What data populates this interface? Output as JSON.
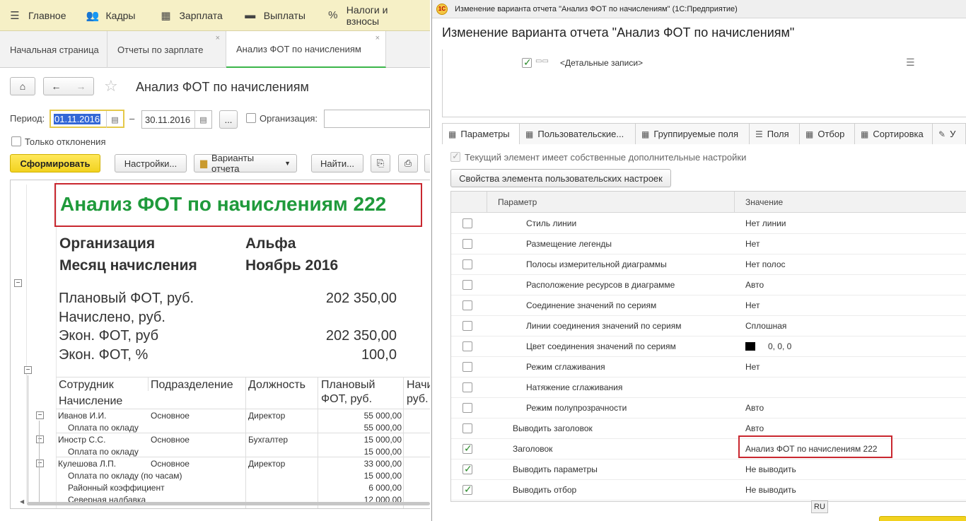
{
  "left": {
    "menu": [
      {
        "icon": "menu-icon",
        "label": "Главное"
      },
      {
        "icon": "people-icon",
        "label": "Кадры"
      },
      {
        "icon": "calculator-icon",
        "label": "Зарплата"
      },
      {
        "icon": "wallet-icon",
        "label": "Выплаты"
      },
      {
        "icon": "percent-icon",
        "label": "Налоги и взносы"
      }
    ],
    "tabs": [
      "Начальная страница",
      "Отчеты по зарплате",
      "Анализ ФОТ по начислениям"
    ],
    "doc_title": "Анализ ФОТ по начислениям",
    "period_label": "Период:",
    "period_from": "01.11.2016",
    "period_dash": "–",
    "period_to": "30.11.2016",
    "dots": "...",
    "org_label": "Организация:",
    "only_deviations": "Только отклонения",
    "buttons": {
      "generate": "Сформировать",
      "settings": "Настройки...",
      "variants": "Варианты отчета",
      "find": "Найти..."
    },
    "report": {
      "title": "Анализ ФОТ по начислениям 222",
      "org_label": "Организация",
      "org_value": "Альфа",
      "month_label": "Месяц начисления",
      "month_value": "Ноябрь 2016",
      "summary": [
        {
          "label": "Плановый ФОТ, руб.",
          "value": "202 350,00"
        },
        {
          "label": "Начислено, руб.",
          "value": ""
        },
        {
          "label": "Экон. ФОТ, руб",
          "value": "202 350,00"
        },
        {
          "label": "Экон. ФОТ, %",
          "value": "100,0"
        }
      ],
      "headers": {
        "employee": "Сотрудник",
        "division": "Подразделение",
        "position": "Должность",
        "plan1": "Плановый",
        "plan2": "ФОТ, руб.",
        "acc1": "Начи",
        "acc2": "руб.",
        "accrual": "Начисление"
      },
      "rows": [
        {
          "name": "Иванов И.И.",
          "div": "Основное",
          "pos": "Директор",
          "plan": "55 000,00",
          "level": 0
        },
        {
          "name": "Оплата по окладу",
          "div": "",
          "pos": "",
          "plan": "55 000,00",
          "level": 1
        },
        {
          "name": "Иностр С.С.",
          "div": "Основное",
          "pos": "Бухгалтер",
          "plan": "15 000,00",
          "level": 0
        },
        {
          "name": "Оплата по окладу",
          "div": "",
          "pos": "",
          "plan": "15 000,00",
          "level": 1
        },
        {
          "name": "Кулешова Л.П.",
          "div": "Основное",
          "pos": "Директор",
          "plan": "33 000,00",
          "level": 0
        },
        {
          "name": "Оплата по окладу (по часам)",
          "div": "",
          "pos": "",
          "plan": "15 000,00",
          "level": 1
        },
        {
          "name": "Районный коэффициент",
          "div": "",
          "pos": "",
          "plan": "6 000,00",
          "level": 1
        },
        {
          "name": "Северная надбавка",
          "div": "",
          "pos": "",
          "plan": "12 000,00",
          "level": 1
        }
      ]
    }
  },
  "right": {
    "window_title": "Изменение варианта отчета \"Анализ ФОТ по начислениям\"  (1С:Предприятие)",
    "form_title": "Изменение варианта отчета \"Анализ ФОТ по начислениям\"",
    "detail_records": "<Детальные записи>",
    "tabs": [
      {
        "icon": "table-icon",
        "label": "Параметры"
      },
      {
        "icon": "table-icon",
        "label": "Пользовательские..."
      },
      {
        "icon": "table-icon",
        "label": "Группируемые поля"
      },
      {
        "icon": "list-icon",
        "label": "Поля"
      },
      {
        "icon": "table-icon",
        "label": "Отбор"
      },
      {
        "icon": "table-icon",
        "label": "Сортировка"
      },
      {
        "icon": "brush-icon",
        "label": "У"
      }
    ],
    "own_settings_label": "Текущий элемент имеет собственные дополнительные настройки",
    "element_props_button": "Свойства элемента пользовательских настроек",
    "grid_headers": {
      "param": "Параметр",
      "value": "Значение"
    },
    "params": [
      {
        "name": "Стиль линии",
        "value": "Нет линии",
        "checked": false,
        "indent": 2
      },
      {
        "name": "Размещение легенды",
        "value": "Нет",
        "checked": false,
        "indent": 2
      },
      {
        "name": "Полосы измерительной диаграммы",
        "value": "Нет полос",
        "checked": false,
        "indent": 2
      },
      {
        "name": "Расположение ресурсов в диаграмме",
        "value": "Авто",
        "checked": false,
        "indent": 2
      },
      {
        "name": "Соединение значений по сериям",
        "value": "Нет",
        "checked": false,
        "indent": 2
      },
      {
        "name": "Линии соединения значений по сериям",
        "value": "Сплошная",
        "checked": false,
        "indent": 2
      },
      {
        "name": "Цвет соединения значений по сериям",
        "value": "0, 0, 0",
        "checked": false,
        "indent": 2,
        "swatch": "#000000"
      },
      {
        "name": "Режим сглаживания",
        "value": "Нет",
        "checked": false,
        "indent": 2
      },
      {
        "name": "Натяжение сглаживания",
        "value": "",
        "checked": false,
        "indent": 2
      },
      {
        "name": "Режим полупрозрачности",
        "value": "Авто",
        "checked": false,
        "indent": 2
      },
      {
        "name": "Выводить заголовок",
        "value": "Авто",
        "checked": false,
        "indent": 1
      },
      {
        "name": "Заголовок",
        "value": "Анализ ФОТ по начислениям 222",
        "checked": true,
        "indent": 1,
        "highlight": true
      },
      {
        "name": "Выводить параметры",
        "value": "Не выводить",
        "checked": true,
        "indent": 1
      },
      {
        "name": "Выводить отбор",
        "value": "Не выводить",
        "checked": true,
        "indent": 1
      }
    ],
    "lang": "RU"
  },
  "colors": {
    "accent_green": "#1f9a3b",
    "highlight_red": "#c9272f",
    "button_yellow": "#f2d21f"
  }
}
